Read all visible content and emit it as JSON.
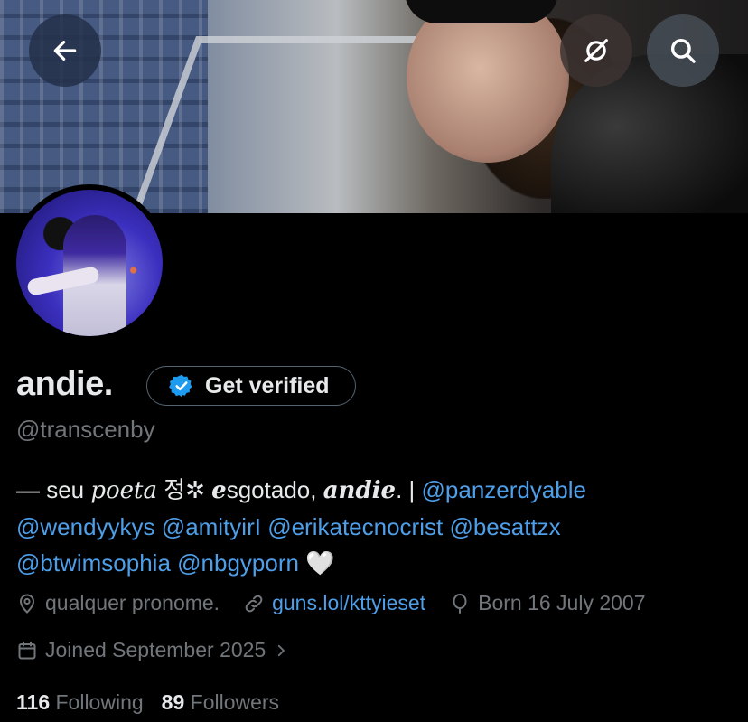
{
  "profile": {
    "name": "andie.",
    "handle": "@transcenby",
    "get_verified_label": "Get verified",
    "bio": {
      "prefix": "— seu ",
      "word_poeta": "poeta",
      "korean": " 정✲ ",
      "word_e": "e",
      "word_sgotado": "sgotado, ",
      "word_andie": "andie",
      "period_bar": ". | ",
      "mention_1": "@panzerdyable",
      "mention_2": "@wendyykys",
      "mention_3": "@amityirI",
      "mention_4": "@erikatecnocrist",
      "mention_5": "@besattzx",
      "mention_6": "@btwimsophia",
      "mention_7": "@nbgyporn",
      "heart": "🤍"
    },
    "location": "qualquer pronome.",
    "website": "guns.lol/kttyieset",
    "birthday": "Born 16 July 2007",
    "joined": "Joined September 2025",
    "following_count": "116",
    "following_label": "Following",
    "followers_count": "89",
    "followers_label": "Followers"
  },
  "icons": {
    "back": "arrow-left-icon",
    "hide": "eye-slash-icon",
    "search": "search-icon",
    "verified": "verified-badge-icon",
    "location": "location-pin-icon",
    "link": "link-icon",
    "birthday": "balloon-icon",
    "calendar": "calendar-icon",
    "chevron": "chevron-right-icon"
  },
  "colors": {
    "background": "#000000",
    "text": "#e7e9ea",
    "secondary_text": "#71767b",
    "link": "#4e9ee8",
    "verified_blue": "#1d9bf0"
  }
}
